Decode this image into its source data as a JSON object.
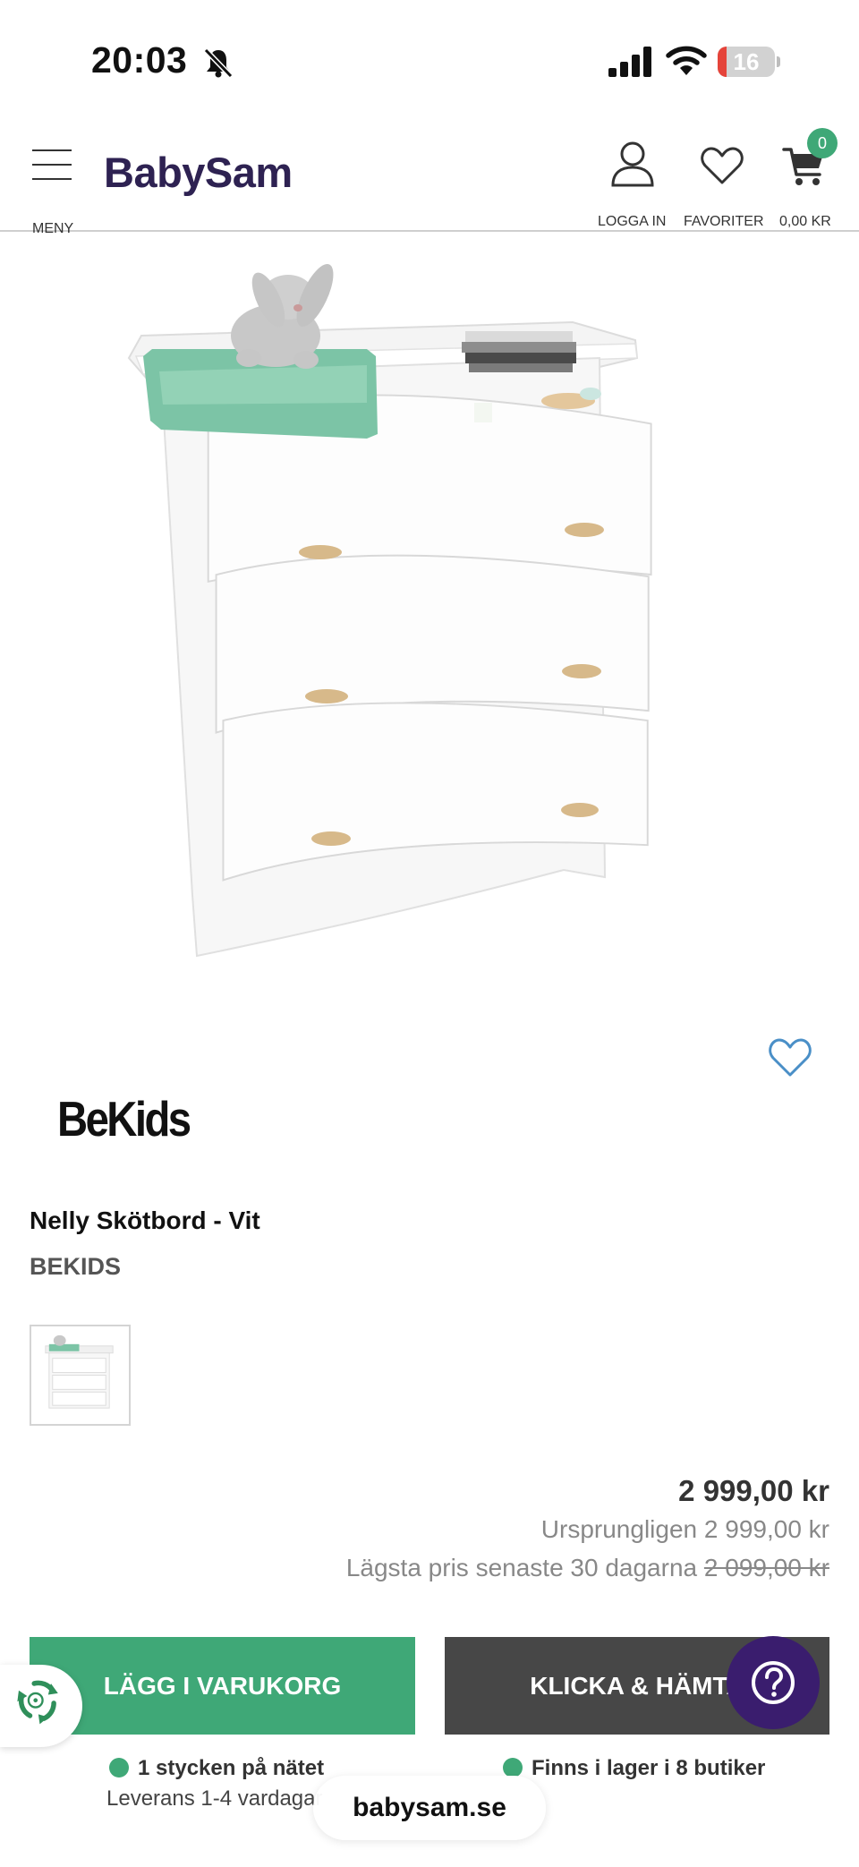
{
  "status_bar": {
    "time": "20:03",
    "battery": "16",
    "battery_fraction": 0.16
  },
  "header": {
    "logo": "BabySam",
    "menu_label": "MENY",
    "login_label": "LOGGA IN",
    "favorites_label": "FAVORITER",
    "cart_total": "0,00 KR",
    "cart_count": "0"
  },
  "product": {
    "brand_logo": "BeKids",
    "title": "Nelly Skötbord - Vit",
    "brand": "BEKIDS",
    "price": "2 999,00 kr",
    "original_price": "Ursprungligen 2 999,00 kr",
    "lowest_price_label": "Lägsta pris senaste 30 dagarna",
    "lowest_price_value": "2 099,00 kr"
  },
  "actions": {
    "add_to_cart": "LÄGG I VARUKORG",
    "click_collect": "KLICKA & HÄMTA"
  },
  "availability": {
    "online": "1 stycken på nätet",
    "stores": "Finns i lager i 8 butiker",
    "delivery": "Leverans 1-4 vardagar"
  },
  "browser": {
    "url": "babysam.se"
  },
  "colors": {
    "brand_green": "#3fa877",
    "dark_button": "#474747",
    "help_purple": "#3a1d6e",
    "logo_purple": "#2e2252"
  },
  "icons": [
    "bell-slash-icon",
    "signal-icon",
    "wifi-icon",
    "hamburger-icon",
    "user-icon",
    "heart-icon",
    "cart-icon",
    "question-icon",
    "recycle-icon"
  ]
}
